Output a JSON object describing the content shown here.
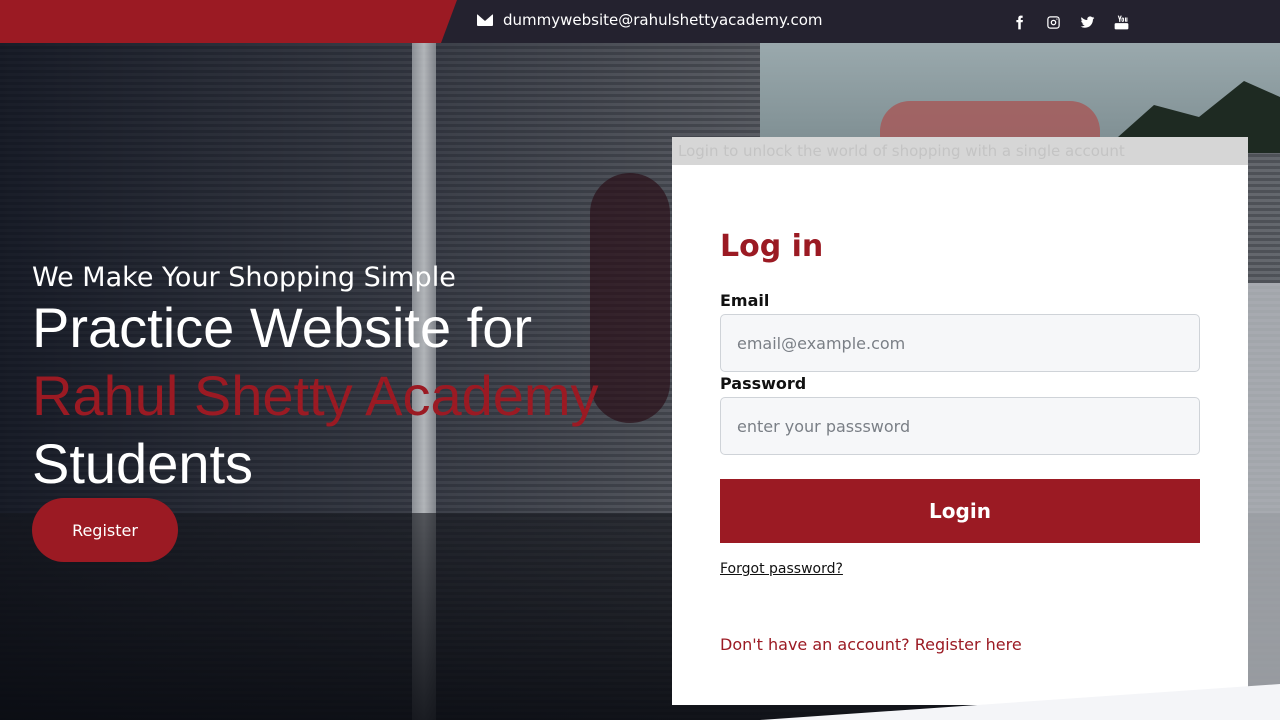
{
  "topbar": {
    "email": "dummywebsite@rahulshettyacademy.com",
    "social_icons": [
      "facebook-icon",
      "instagram-icon",
      "twitter-icon",
      "youtube-icon"
    ]
  },
  "hero": {
    "tagline": "We Make Your Shopping Simple",
    "headline_line1": "Practice Website for",
    "headline_accent": "Rahul Shetty Academy",
    "headline_line3": "Students",
    "register_button": "Register"
  },
  "login": {
    "banner_text": "Login to unlock the world of shopping with a single account",
    "title": "Log in",
    "email_label": "Email",
    "email_placeholder": "email@example.com",
    "password_label": "Password",
    "password_placeholder": "enter your passsword",
    "login_button": "Login",
    "forgot_password": "Forgot password?",
    "register_link": "Don't have an account? Register here"
  },
  "colors": {
    "brand_red": "#9b1a23",
    "topbar_bg": "#24222f"
  }
}
